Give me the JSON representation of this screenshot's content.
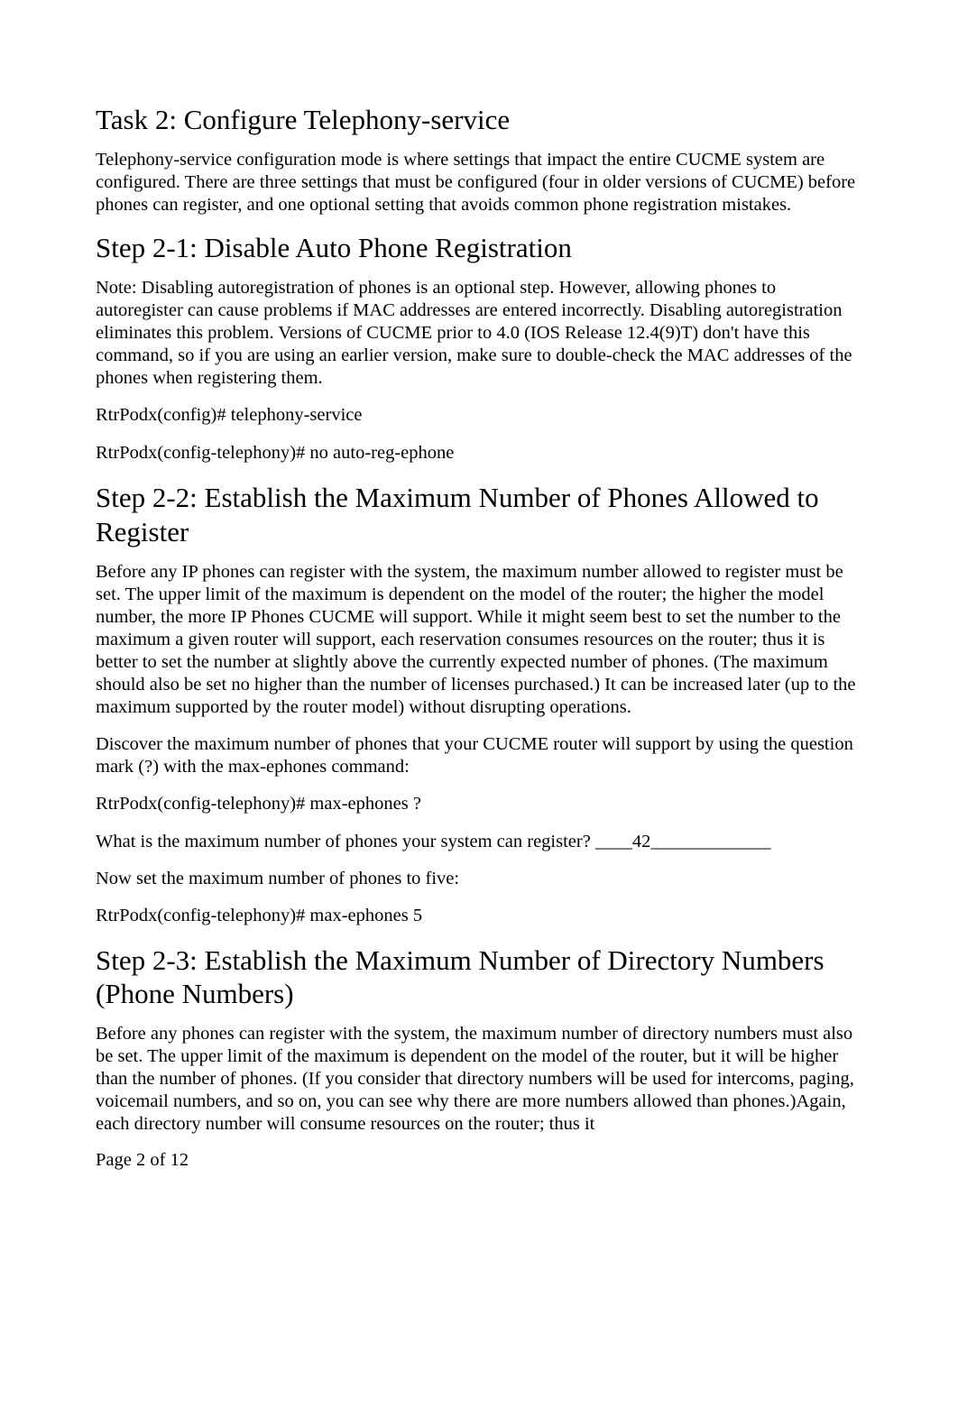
{
  "task2": {
    "heading": "Task 2: Configure Telephony-service",
    "intro": "Telephony-service configuration mode is where settings that impact the entire CUCME system are configured. There are three settings that must be configured (four in older versions of CUCME) before phones can register, and one optional setting that avoids common phone registration mistakes."
  },
  "step21": {
    "heading": "Step 2-1: Disable Auto Phone Registration",
    "note_label": "Note:",
    "note_body": " Disabling autoregistration of phones is an optional step. However, allowing phones to autoregister can cause problems if MAC addresses are entered incorrectly. Disabling autoregistration eliminates this problem. Versions of CUCME prior to 4.0 (IOS Release 12.4(9)T) don't have this command, so if you are using an earlier version, make sure to double-check the MAC addresses of the phones when registering them.",
    "cmd1_prompt": "RtrPodx(config)#",
    "cmd1_command": " telephony-service",
    "cmd2_prompt": "RtrPodx(config-telephony)#",
    "cmd2_command": " no auto-reg-ephone"
  },
  "step22": {
    "heading": "Step 2-2: Establish the Maximum Number of Phones Allowed to Register",
    "para1": "Before any IP phones can register with the system, the maximum number allowed to register must be set. The upper limit of the maximum is dependent on the model of the router; the higher the model number, the more IP Phones CUCME will support. While it might seem best to set the number to the maximum a given router will support, each reservation consumes resources on the router; thus it is better to set the number at slightly above the currently expected number of phones. (The maximum should also be set no higher than the number of licenses purchased.) It can be increased later (up to the maximum supported by the router model) without disrupting operations.",
    "para2_a": "Discover the maximum number of phones that your CUCME router will support by using the question mark (",
    "para2_q": "?",
    "para2_b": ") with the",
    "para2_cmd": " max-ephones ",
    "para2_c": " command:",
    "cmd1_prompt": "RtrPodx(config-telephony)#",
    "cmd1_command": " max-ephones ?",
    "question": "What is the maximum number of phones your system can register? ____42_____________",
    "para3": "Now set the maximum number of phones to five:",
    "cmd2_prompt": "RtrPodx(config-telephony)#",
    "cmd2_command": " max-ephones 5"
  },
  "step23": {
    "heading": "Step 2-3: Establish the Maximum Number of Directory Numbers (Phone Numbers)",
    "para1": "Before any phones can register with the system, the maximum number of directory numbers must also be set. The upper limit of the maximum is dependent on the model of the router, but it will be higher than the number of phones. (If you consider that directory numbers will be used for intercoms, paging, voicemail numbers, and so on, you can see why there are more numbers allowed than phones.)Again, each directory number will consume resources on the router; thus it"
  },
  "footer": {
    "page_label": "Page",
    "page_num": "2",
    "page_of": " of ",
    "page_total": "12"
  }
}
